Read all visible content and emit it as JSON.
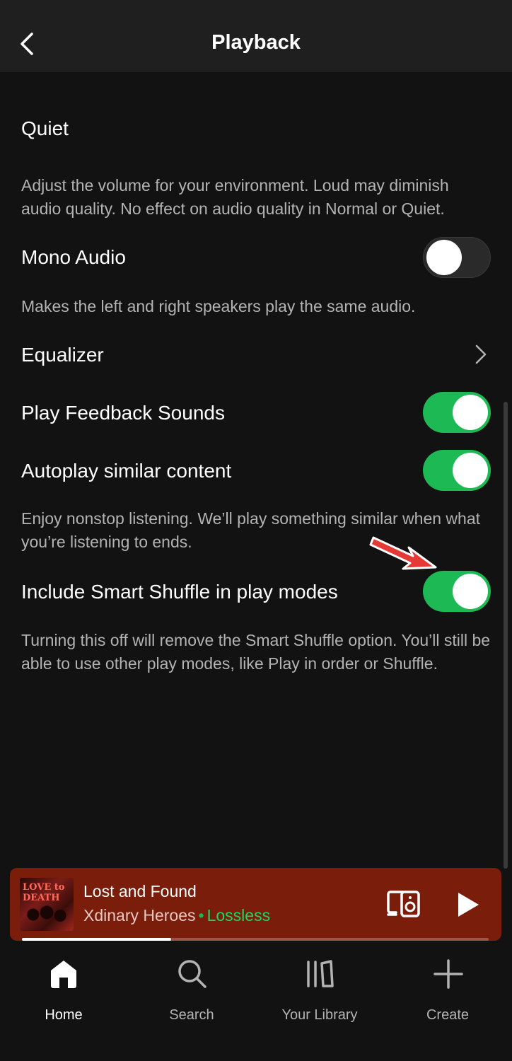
{
  "header": {
    "title": "Playback"
  },
  "settings": {
    "volume_level": "Quiet",
    "volume_desc": "Adjust the volume for your environment. Loud may diminish audio quality. No effect on audio quality in Normal or Quiet.",
    "mono_audio": {
      "label": "Mono Audio",
      "enabled": false,
      "desc": "Makes the left and right speakers play the same audio."
    },
    "equalizer": {
      "label": "Equalizer"
    },
    "feedback_sounds": {
      "label": "Play Feedback Sounds",
      "enabled": true
    },
    "autoplay": {
      "label": "Autoplay similar content",
      "enabled": true,
      "desc": "Enjoy nonstop listening. We’ll play something similar when what you’re listening to ends."
    },
    "smart_shuffle": {
      "label": "Include Smart Shuffle in play modes",
      "enabled": true,
      "desc": "Turning this off will remove the Smart Shuffle option. You’ll still be able to use other play modes, like Play in order or Shuffle."
    }
  },
  "player": {
    "title": "Lost and Found",
    "artist": "Xdinary Heroes",
    "separator": "•",
    "quality": "Lossless",
    "art_text": "LOVE to DEATH",
    "progress": 0.32
  },
  "nav": {
    "home": "Home",
    "search": "Search",
    "library": "Your Library",
    "create": "Create"
  },
  "colors": {
    "accent": "#1db954",
    "player_bg": "#7a1d0a",
    "background": "#121212"
  }
}
